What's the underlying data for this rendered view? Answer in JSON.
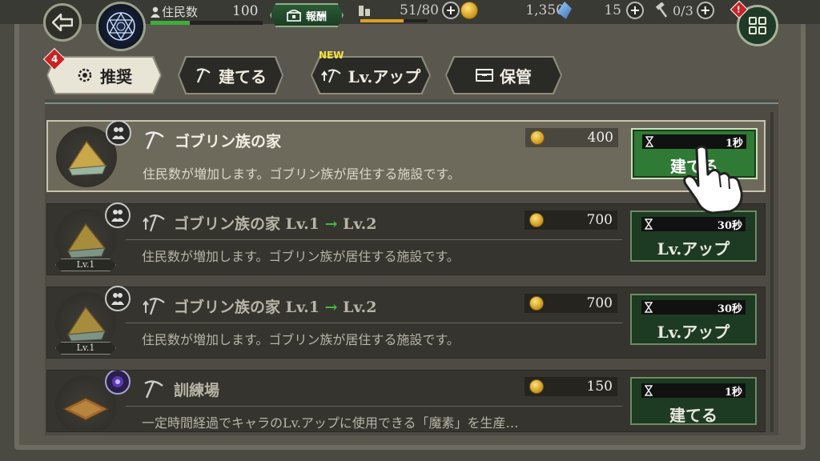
{
  "topbar": {
    "resident_label": "住民数",
    "resident_count": "100",
    "resident_fill": 0.35,
    "reward_label": "報酬",
    "capacity": "51/80",
    "capacity_fill": 0.64,
    "gold": "1,350",
    "crystals": "15",
    "hammers": "0/3",
    "alert_badge": "!"
  },
  "tabs": [
    {
      "label": "推奨",
      "badge": "4",
      "active": true
    },
    {
      "label": "建てる"
    },
    {
      "label": "Lv.アップ",
      "new_label": "NEW"
    },
    {
      "label": "保管"
    }
  ],
  "cards": [
    {
      "title": "ゴブリン族の家",
      "desc": "住民数が増加します。ゴブリン族が居住する施設です。",
      "cost": "400",
      "time": "1秒",
      "action": "建てる",
      "level_tag": "",
      "type_icon": "residents-icon",
      "action_icon": "pickaxe-icon"
    },
    {
      "title_prefix": "ゴブリン族の家 Lv.1",
      "arrow": "→",
      "title_suffix": "Lv.2",
      "desc": "住民数が増加します。ゴブリン族が居住する施設です。",
      "cost": "700",
      "time": "30秒",
      "action": "Lv.アップ",
      "level_tag": "Lv.1",
      "type_icon": "residents-icon",
      "action_icon": "upgrade-pickaxe-icon"
    },
    {
      "title_prefix": "ゴブリン族の家 Lv.1",
      "arrow": "→",
      "title_suffix": "Lv.2",
      "desc": "住民数が増加します。ゴブリン族が居住する施設です。",
      "cost": "700",
      "time": "30秒",
      "action": "Lv.アップ",
      "level_tag": "Lv.1",
      "type_icon": "residents-icon",
      "action_icon": "upgrade-pickaxe-icon"
    },
    {
      "title": "訓練場",
      "desc": "一定時間経過でキャラのLv.アップに使用できる「魔素」を生産…",
      "cost": "150",
      "time": "1秒",
      "action": "建てる",
      "level_tag": "",
      "type_icon": "magic-orb-icon",
      "action_icon": "pickaxe-icon"
    }
  ],
  "colors": {
    "accent_green": "#2f7a34",
    "arrow_green": "#3cbf3c",
    "badge_red": "#c82424",
    "gold": "#e0a020"
  }
}
